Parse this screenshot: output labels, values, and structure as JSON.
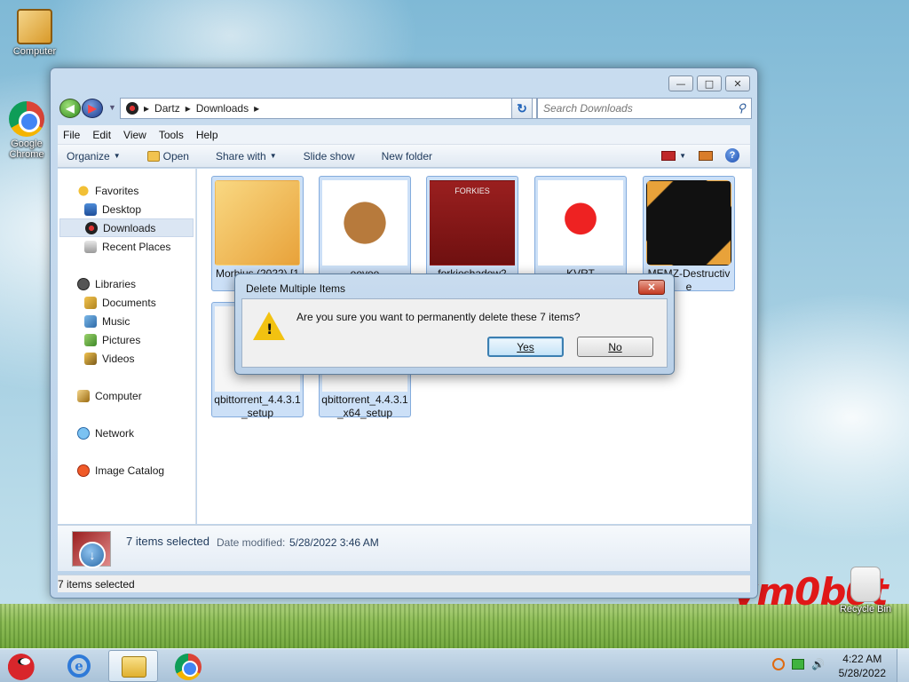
{
  "desktop": {
    "icons": [
      {
        "label": "Computer"
      },
      {
        "label": "Google Chrome"
      },
      {
        "label": "Recycle Bin"
      }
    ],
    "watermark": "vm0b0t"
  },
  "explorer": {
    "breadcrumb": [
      "Dartz",
      "Downloads"
    ],
    "search_placeholder": "Search Downloads",
    "menu": [
      "File",
      "Edit",
      "View",
      "Tools",
      "Help"
    ],
    "commands": {
      "organize": "Organize",
      "open": "Open",
      "share_with": "Share with",
      "slide_show": "Slide show",
      "new_folder": "New folder"
    },
    "nav": {
      "favorites": "Favorites",
      "desktop": "Desktop",
      "downloads": "Downloads",
      "recent_places": "Recent Places",
      "libraries": "Libraries",
      "documents": "Documents",
      "music": "Music",
      "pictures": "Pictures",
      "videos": "Videos",
      "computer": "Computer",
      "network": "Network",
      "image_catalog": "Image Catalog"
    },
    "files": [
      {
        "name": "Morbius (2022) [1080...",
        "selected": true
      },
      {
        "name": "eevee",
        "selected": true
      },
      {
        "name": "forkieshadow2",
        "thumb_text": "FORKIES",
        "selected": true
      },
      {
        "name": "KVRT",
        "selected": true
      },
      {
        "name": "MEMZ-Destructive",
        "selected": true
      },
      {
        "name": "qbittorrent_4.4.3.1_setup",
        "selected": true
      },
      {
        "name": "qbittorrent_4.4.3.1_x64_setup",
        "selected": true
      }
    ],
    "details": {
      "count": "7 items selected",
      "date_label": "Date modified:",
      "date_value": "5/28/2022 3:46 AM"
    },
    "status": "7 items selected"
  },
  "dialog": {
    "title": "Delete Multiple Items",
    "message": "Are you sure you want to permanently delete these 7 items?",
    "yes": "Yes",
    "no": "No"
  },
  "taskbar": {
    "time": "4:22 AM",
    "date": "5/28/2022"
  }
}
